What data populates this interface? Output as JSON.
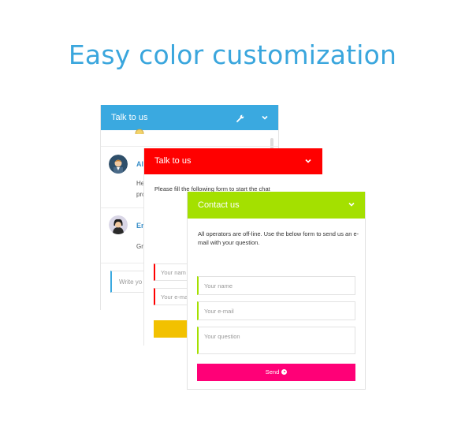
{
  "headline": "Easy color customization",
  "colors": {
    "headline": "#3aa6dd",
    "panel1_accent": "#3aa9e0",
    "panel2_accent": "#ff0000",
    "panel2_button": "#f2c100",
    "panel3_accent": "#a4e000",
    "panel3_button": "#ff0077"
  },
  "panel1": {
    "title": "Talk to us",
    "icons": [
      "wrench-icon",
      "chevron-down-icon"
    ],
    "messages": [
      {
        "name": "Al",
        "text_lines": [
          "He",
          "pro"
        ]
      },
      {
        "name": "En",
        "text_lines": [
          "Gre"
        ]
      }
    ],
    "input_placeholder": "Write yo"
  },
  "panel2": {
    "title": "Talk to us",
    "intro": "Please fill the following form to start the chat",
    "name_placeholder": "Your nam",
    "email_placeholder": "Your e-ma"
  },
  "panel3": {
    "title": "Contact us",
    "intro": "All operators are off-line. Use the below form to send us an e-mail with your question.",
    "name_placeholder": "Your name",
    "email_placeholder": "Your e-mail",
    "question_placeholder": "Your question",
    "send_label": "Send"
  }
}
